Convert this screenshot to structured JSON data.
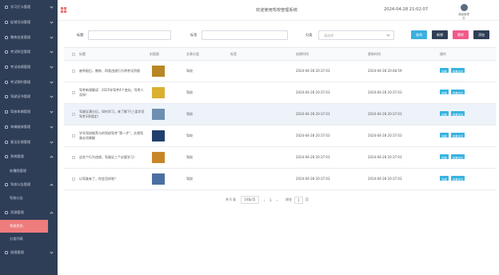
{
  "sidebar": {
    "items": [
      {
        "label": "学习打卡管理"
      },
      {
        "label": "促销活动管理"
      },
      {
        "label": "教练信息管理"
      },
      {
        "label": "考试科目管理"
      },
      {
        "label": "考试成绩管理"
      },
      {
        "label": "考试预约管理"
      },
      {
        "label": "驾驶证书管理"
      },
      {
        "label": "驾校车辆管理"
      },
      {
        "label": "车辆维修管理"
      },
      {
        "label": "意见反馈管理"
      },
      {
        "label": "系统管理"
      },
      {
        "label": "轮播图管理"
      },
      {
        "label": "驾校公告管理"
      },
      {
        "label": "驾校公告"
      },
      {
        "label": "资源管理"
      },
      {
        "label": "驾校资讯"
      },
      {
        "label": "分类列表"
      },
      {
        "label": "权限管理"
      }
    ]
  },
  "header": {
    "system_title": "欢迎使用驾校管理系统",
    "datetime": "2024-04-28 21:02:07",
    "user_name": "超级管理员"
  },
  "search": {
    "title_label": "标题",
    "tag_label": "标签",
    "category_label": "分类",
    "category_placeholder": "请选择",
    "query_btn": "查询",
    "add_btn": "新增",
    "delete_btn": "删除",
    "export_btn": "添加"
  },
  "colors": {
    "query": "#3bb0e0",
    "add": "#2f3e57",
    "delete": "#f05a8a",
    "export": "#2f3e57"
  },
  "table": {
    "headers": [
      "标题",
      "封面图",
      "文章分类",
      "标签",
      "创建时间",
      "更新时间",
      "操作"
    ],
    "row_actions": [
      "详情",
      "查看评论"
    ],
    "rows": [
      {
        "title": "被举报后，教练、四类违规行为将考试资格",
        "category": "驾校",
        "tag": "",
        "created": "2024-04-28 20:37:03",
        "updated": "2024-04-28 20:48:59",
        "thumb": "#b88624"
      },
      {
        "title": "驾考新规解读：2025年驾考4个变化，驾考人须知！",
        "category": "驾校",
        "tag": "",
        "created": "2024-04-28 20:37:03",
        "updated": "2024-04-28 20:37:03",
        "thumb": "#d9b030"
      },
      {
        "title": "驾驶证满分后，如何学习，来了解下(三类学员驾考3项规定)",
        "category": "驾校",
        "tag": "",
        "created": "2024-04-28 20:37:03",
        "updated": "2024-04-28 20:37:03",
        "thumb": "#6e8fb0"
      },
      {
        "title": "学车驾校推荐与的驾校驾考”第一步”，交规驾驶必须掌握",
        "category": "驾校",
        "tag": "",
        "created": "2024-04-28 20:37:03",
        "updated": "2024-04-28 20:37:03",
        "thumb": "#1f3f6e"
      },
      {
        "title": "这些个行为违规，驾驶证三个必要学习！",
        "category": "驾校",
        "tag": "",
        "created": "2024-04-28 20:37:03",
        "updated": "2024-04-28 20:37:03",
        "thumb": "#c8862a"
      },
      {
        "title": "以驾驶来了，你会怎样呢？",
        "category": "驾校",
        "tag": "",
        "created": "2024-04-28 20:37:03",
        "updated": "2024-04-28 20:37:03",
        "thumb": "#4b6fa0"
      }
    ]
  },
  "pager": {
    "total": "共 6 条",
    "size": "10条/页",
    "prev": "‹",
    "page": "1",
    "next": "›",
    "goto": "前往",
    "goto_val": "1",
    "unit": "页"
  },
  "watermark": "CSDN @kybs1991"
}
